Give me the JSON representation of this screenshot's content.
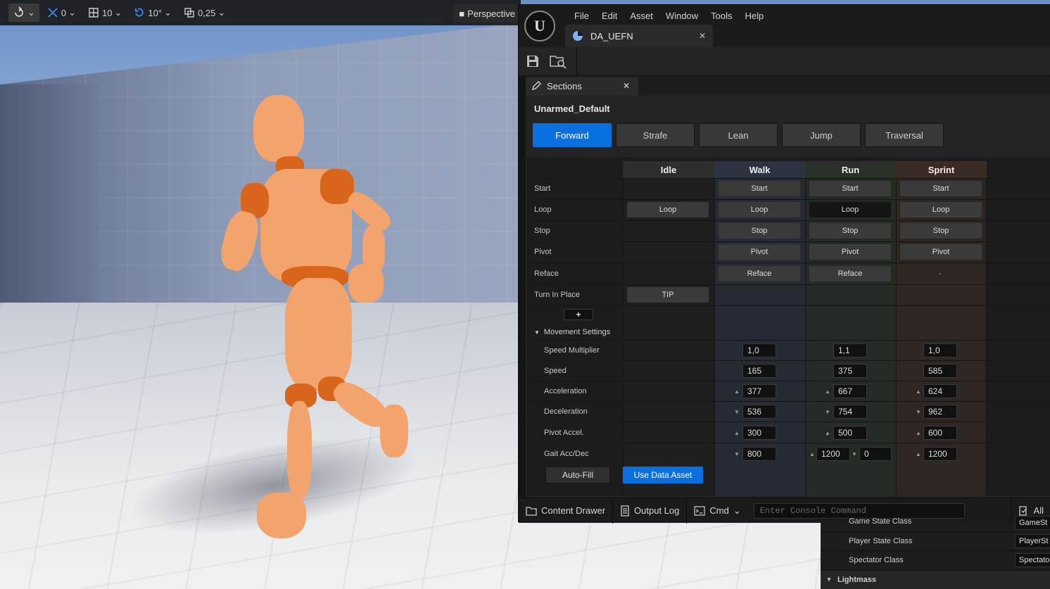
{
  "viewport_toolbar": {
    "items": [
      {
        "name": "transform-mode",
        "value": ""
      },
      {
        "name": "surface-snap",
        "value": "0"
      },
      {
        "name": "grid-snap",
        "value": "10"
      },
      {
        "name": "rotation-snap",
        "value": "10°"
      },
      {
        "name": "scale-snap",
        "value": "0,25"
      }
    ],
    "perspective_label": "Perspective"
  },
  "menu": [
    "File",
    "Edit",
    "Asset",
    "Window",
    "Tools",
    "Help"
  ],
  "document_tab": {
    "label": "DA_UEFN"
  },
  "sections_tab": {
    "label": "Sections"
  },
  "asset_name": "Unarmed_Default",
  "tabs": [
    "Forward",
    "Strafe",
    "Lean",
    "Jump",
    "Traversal"
  ],
  "active_tab": "Forward",
  "columns": [
    "Idle",
    "Walk",
    "Run",
    "Sprint"
  ],
  "rows": [
    {
      "label": "Start",
      "cells": [
        "",
        "Start",
        "Start",
        "Start"
      ]
    },
    {
      "label": "Loop",
      "cells": [
        "Loop",
        "Loop",
        "Loop",
        "Loop"
      ]
    },
    {
      "label": "Stop",
      "cells": [
        "",
        "Stop",
        "Stop",
        "Stop"
      ]
    },
    {
      "label": "Pivot",
      "cells": [
        "",
        "Pivot",
        "Pivot",
        "Pivot"
      ]
    },
    {
      "label": "Reface",
      "cells": [
        "",
        "Reface",
        "Reface",
        "-"
      ]
    },
    {
      "label": "Turn In Place",
      "cells": [
        "TIP",
        "",
        "",
        ""
      ]
    }
  ],
  "add_button": "+",
  "movement_settings": {
    "header": "Movement Settings",
    "rows": [
      {
        "label": "Speed Multiplier",
        "walk": "1,0",
        "run": "1,1",
        "sprint": "1,0",
        "arrow": ""
      },
      {
        "label": "Speed",
        "walk": "165",
        "run": "375",
        "sprint": "585",
        "arrow": ""
      },
      {
        "label": "Acceleration",
        "walk": "377",
        "run": "667",
        "sprint": "624",
        "arrow": "▲"
      },
      {
        "label": "Deceleration",
        "walk": "536",
        "run": "754",
        "sprint": "962",
        "arrow": "▼"
      },
      {
        "label": "Pivot Accel.",
        "walk": "300",
        "run": "500",
        "sprint": "600",
        "arrow": "▲"
      },
      {
        "label": "Gait Acc/Dec",
        "walk": "800",
        "run": "1200",
        "run2": "0",
        "sprint": "1200",
        "arrow": ""
      }
    ]
  },
  "actions": {
    "auto_fill": "Auto-Fill",
    "use_data_asset": "Use Data Asset"
  },
  "statusbar": {
    "content_drawer": "Content Drawer",
    "output_log": "Output Log",
    "cmd": "Cmd",
    "console_placeholder": "Enter Console Command",
    "all": "All"
  },
  "background_panel": {
    "rows": [
      {
        "label": "Game State Class",
        "value": "GameSt"
      },
      {
        "label": "Player State Class",
        "value": "PlayerSt"
      },
      {
        "label": "Spectator Class",
        "value": "Spectato"
      }
    ],
    "section": "Lightmass"
  },
  "colors": {
    "accent": "#0a70e0",
    "walk": "#262a33",
    "run": "#242a24",
    "sprint": "#2e2622",
    "mannequin": "#f2a46c"
  }
}
